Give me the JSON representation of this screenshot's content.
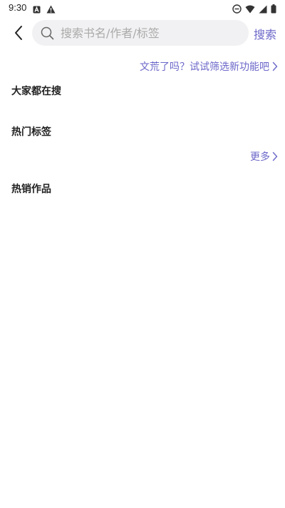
{
  "status_bar": {
    "time": "9:30",
    "left_icons": [
      "a-badge-icon",
      "warning-icon"
    ],
    "right_icons": [
      "dnd-icon",
      "wifi-icon",
      "signal-icon",
      "battery-icon"
    ]
  },
  "header": {
    "back_icon": "chevron-left-icon",
    "search_placeholder": "搜索书名/作者/标签",
    "search_value": "",
    "search_button": "搜索"
  },
  "filter_prompt": "文荒了吗？试试筛选新功能吧",
  "sections": {
    "trending": {
      "title": "大家都在搜"
    },
    "hot_tags": {
      "title": "热门标签",
      "more_label": "更多"
    },
    "bestsellers": {
      "title": "热销作品"
    }
  },
  "colors": {
    "accent": "#6b67c9",
    "search_bg": "#f1f1f3",
    "placeholder": "#aaaaaa"
  }
}
